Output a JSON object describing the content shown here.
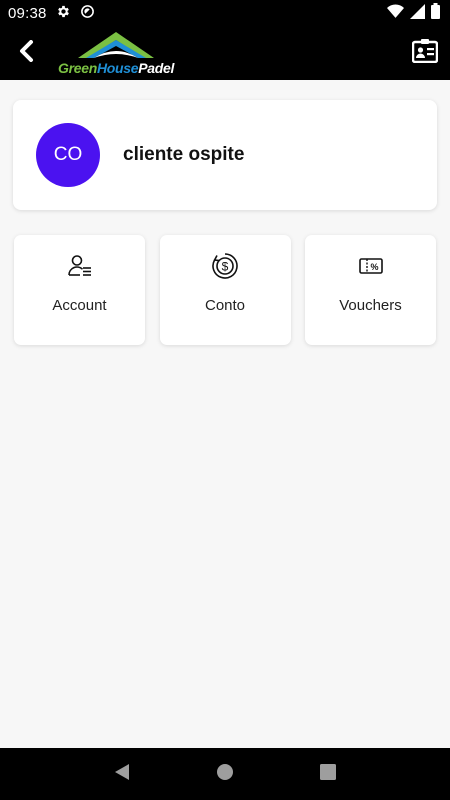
{
  "status_bar": {
    "time": "09:38",
    "icons": [
      "gear-icon",
      "do-not-disturb-icon",
      "wifi-icon",
      "signal-icon",
      "battery-icon"
    ]
  },
  "app_bar": {
    "back_icon": "chevron-left-icon",
    "logo": {
      "part1": "Green",
      "part2": "House",
      "part3": "Padel"
    },
    "contact_icon": "contact-card-icon"
  },
  "profile": {
    "initials": "CO",
    "name": "cliente ospite",
    "avatar_color": "#4b12f0"
  },
  "tiles": [
    {
      "label": "Account",
      "icon": "user-list-icon"
    },
    {
      "label": "Conto",
      "icon": "dollar-coin-icon"
    },
    {
      "label": "Vouchers",
      "icon": "voucher-percent-icon"
    }
  ],
  "nav_bar": {
    "icons": [
      "back-triangle-icon",
      "home-circle-icon",
      "recents-square-icon"
    ]
  },
  "colors": {
    "background": "#f7f7f7",
    "bars": "#000000",
    "accent": "#4b12f0",
    "logo_green": "#7bc043",
    "logo_blue": "#1f8fd6"
  }
}
